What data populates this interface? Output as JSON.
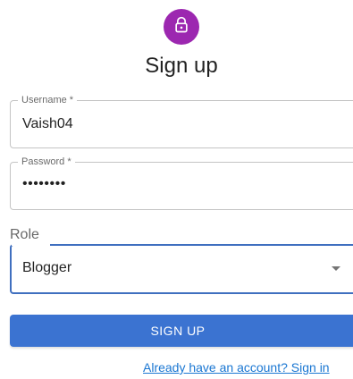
{
  "header": {
    "icon": "lock-icon",
    "avatar_color": "#9c27b0",
    "title": "Sign up"
  },
  "form": {
    "username": {
      "label": "Username *",
      "value": "Vaish04"
    },
    "password": {
      "label": "Password *",
      "value": "••••••••"
    },
    "role": {
      "label": "Role",
      "selected": "Blogger"
    },
    "submit_label": "SIGN UP",
    "signin_link": "Already have an account? Sign in"
  },
  "colors": {
    "primary": "#3b73d1",
    "link": "#1976d2"
  }
}
